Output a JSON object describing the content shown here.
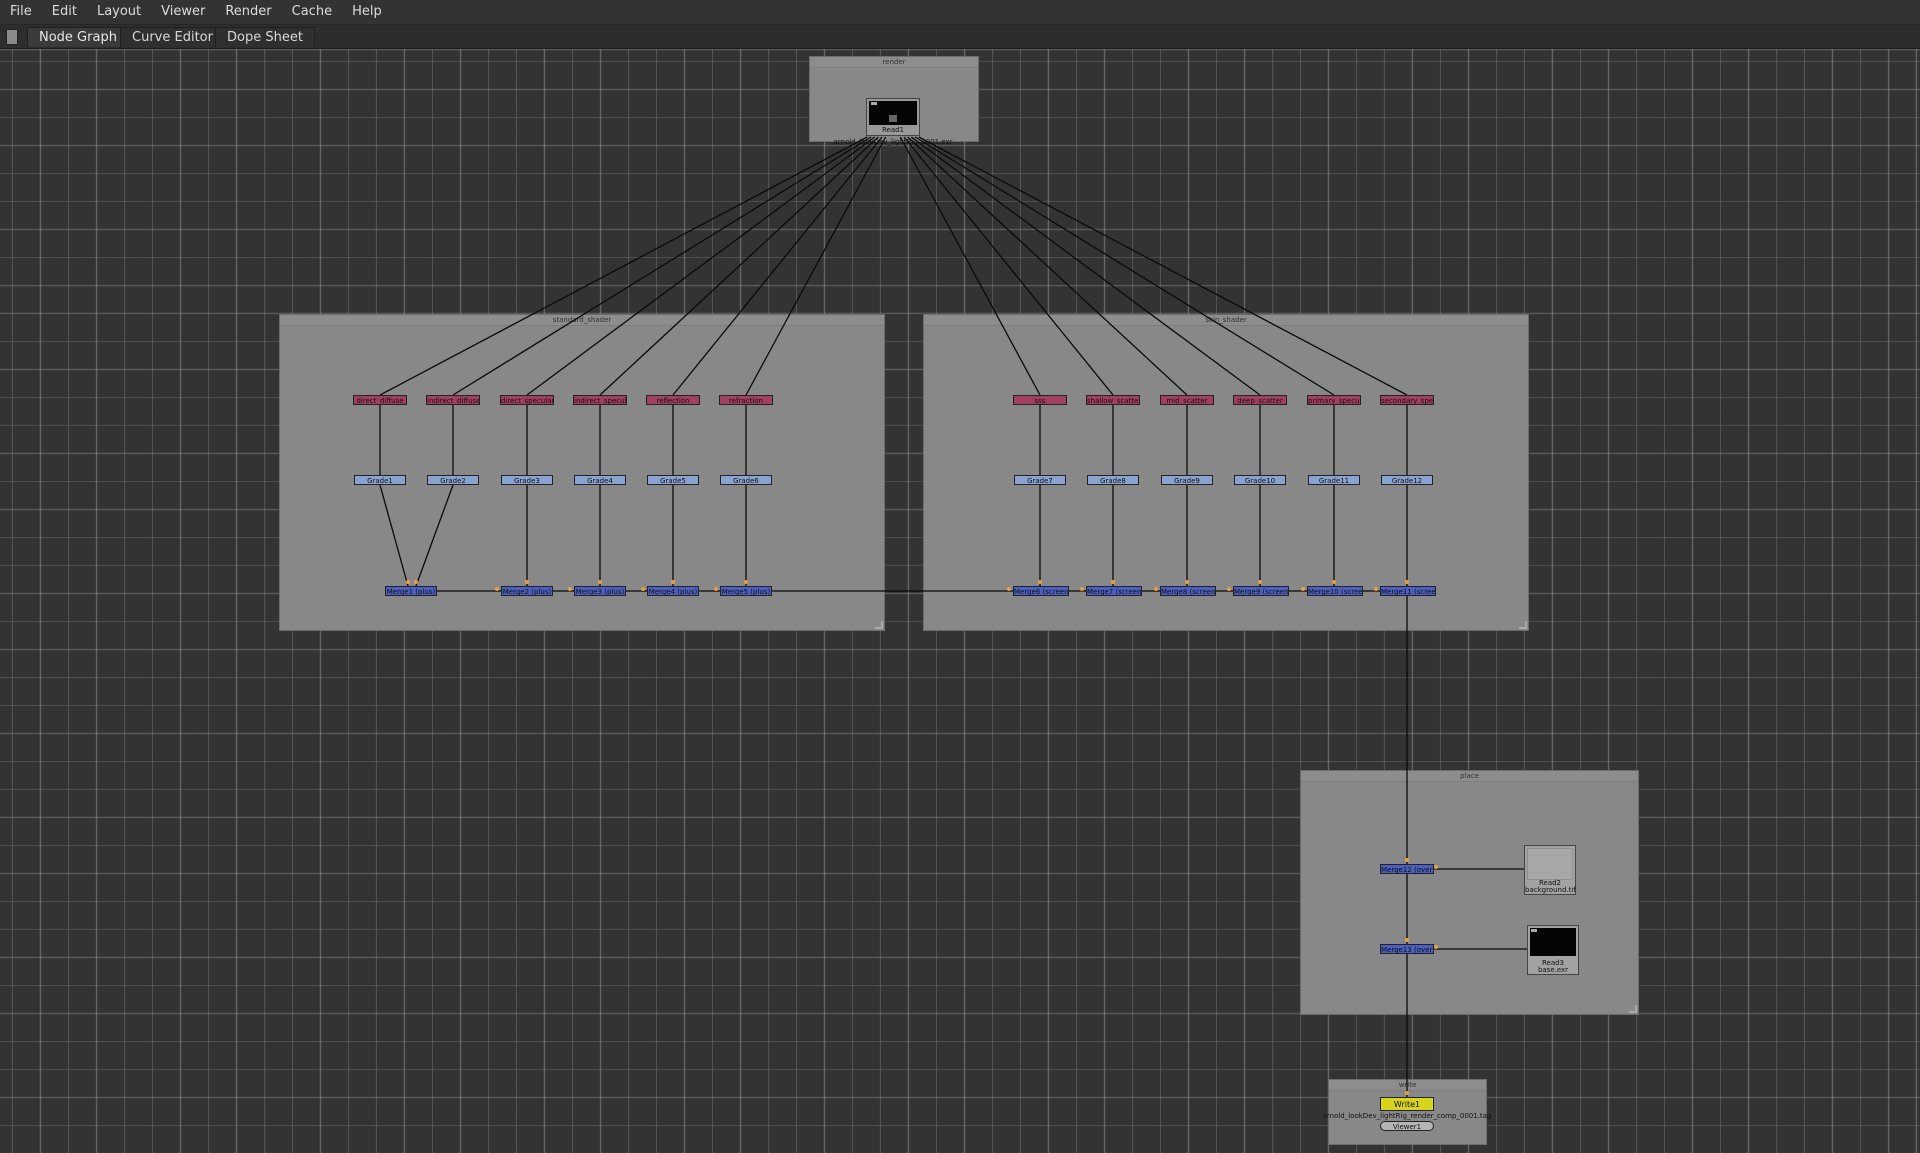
{
  "menu": [
    "File",
    "Edit",
    "Layout",
    "Viewer",
    "Render",
    "Cache",
    "Help"
  ],
  "tabs": [
    {
      "label": "Node Graph",
      "active": true
    },
    {
      "label": "Curve Editor",
      "active": false
    },
    {
      "label": "Dope Sheet",
      "active": false
    }
  ],
  "window_controls": "⧉ ✕",
  "backdrops": {
    "render": "render",
    "standard_shader": "standard_shader",
    "skin_shader": "skin_shader",
    "place": "place",
    "write": "write"
  },
  "read1": {
    "name": "Read1",
    "file": "arnold_lookDev_lightRig_0001.exr"
  },
  "read2": {
    "name": "Read2",
    "file": "background.tif"
  },
  "read3": {
    "name": "Read3",
    "file": "base.exr"
  },
  "shuffles_standard": [
    "direct_diffuse",
    "indirect_diffuse",
    "direct_specular",
    "indirect_specular",
    "reflection",
    "refraction"
  ],
  "shuffles_skin": [
    "sss",
    "shallow_scatter",
    "mid_scatter",
    "deep_scatter",
    "primary_specular",
    "secondary_specular"
  ],
  "grades_standard": [
    "Grade1",
    "Grade2",
    "Grade3",
    "Grade4",
    "Grade5",
    "Grade6"
  ],
  "grades_skin": [
    "Grade7",
    "Grade8",
    "Grade9",
    "Grade10",
    "Grade11",
    "Grade12"
  ],
  "merges_standard": [
    "Merge1 (plus)",
    "Merge2 (plus)",
    "Merge3 (plus)",
    "Merge4 (plus)",
    "Merge5 (plus)"
  ],
  "merges_skin": [
    "Merge6 (screen)",
    "Merge7 (screen)",
    "Merge8 (screen)",
    "Merge9 (screen)",
    "Merge10 (screen)",
    "Merge11 (screen)"
  ],
  "merges_place": [
    "Merge12 (over)",
    "Merge13 (over)"
  ],
  "write1": {
    "name": "Write1",
    "file": "arnold_lookDev_lightRig_render_comp_0001.tag"
  },
  "viewer1": "Viewer1",
  "colors": {
    "shuffle": "#a0405e",
    "grade": "#8aa2cf",
    "merge": "#4a5fc0",
    "write": "#d7d41c",
    "backdrop": "#888888"
  }
}
